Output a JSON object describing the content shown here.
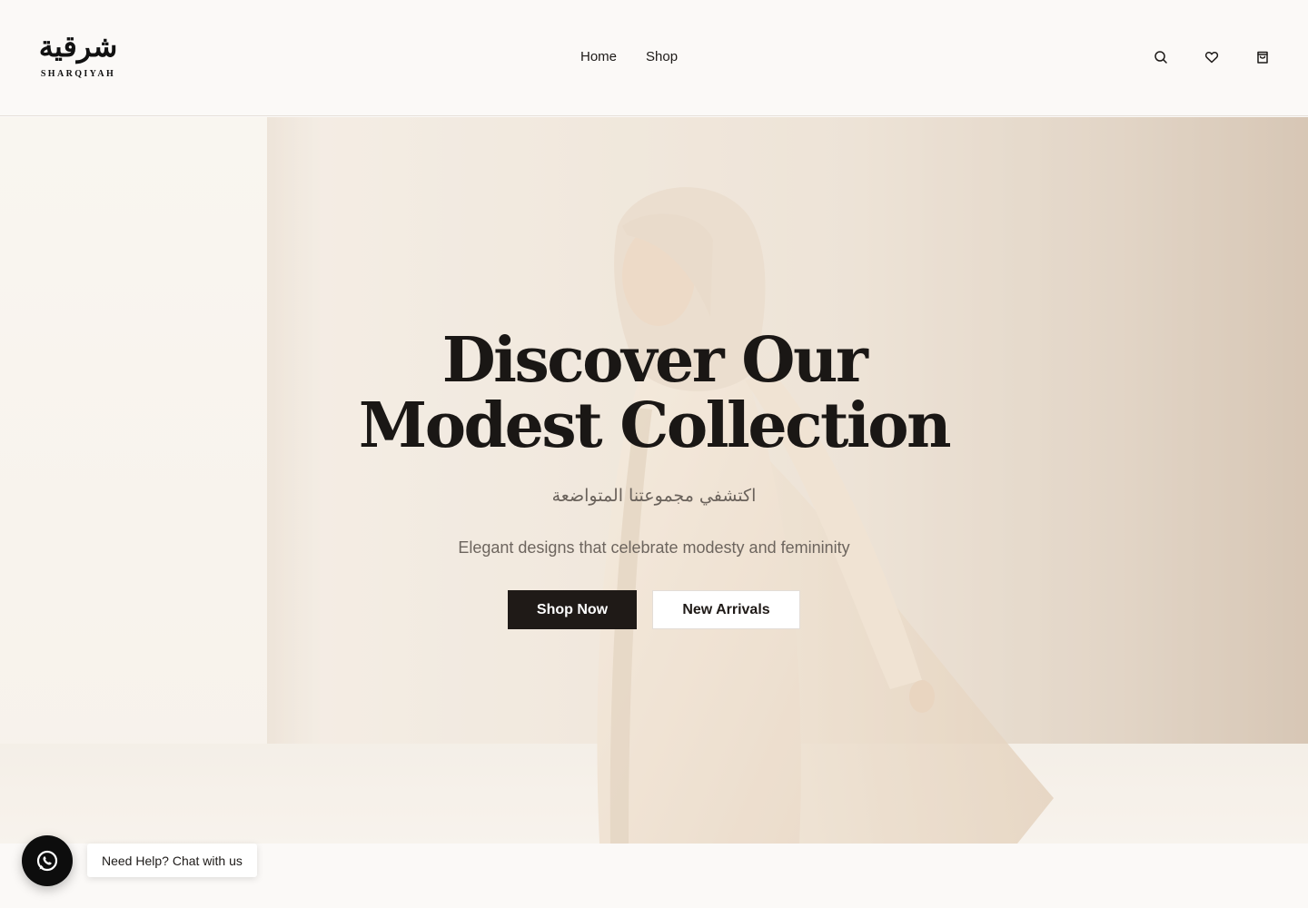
{
  "brand": {
    "logo_arabic": "شرقية",
    "logo_latin": "SHARQIYAH"
  },
  "nav": {
    "items": [
      {
        "label": "Home"
      },
      {
        "label": "Shop"
      }
    ]
  },
  "header_icons": [
    "search-icon",
    "heart-icon",
    "shopping-bag-icon"
  ],
  "hero": {
    "title_line1": "Discover Our",
    "title_line2": "Modest Collection",
    "subtitle_arabic": "اكتشفي مجموعتنا المتواضعة",
    "tagline": "Elegant designs that celebrate modesty and femininity",
    "primary_button": "Shop Now",
    "secondary_button": "New Arrivals"
  },
  "chat": {
    "icon": "whatsapp-icon",
    "label": "Need Help? Chat with us"
  },
  "colors": {
    "primary_dark": "#1f1a17",
    "background": "#fbf9f7",
    "hero_beige": "#eee3d6"
  }
}
